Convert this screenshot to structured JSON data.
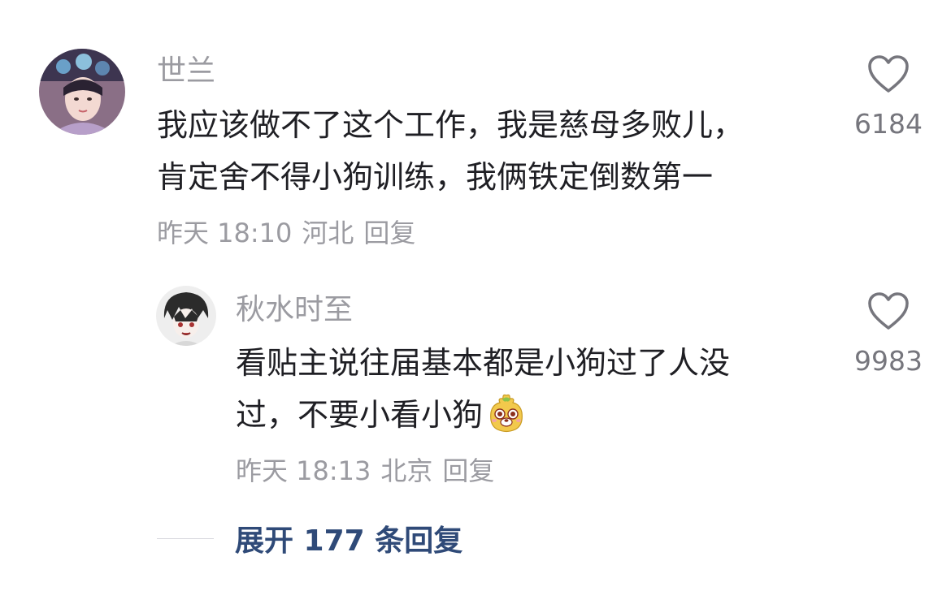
{
  "comments": [
    {
      "username": "世兰",
      "content_lines": [
        "我应该做不了这个工作，我是慈母多败儿，",
        "肯定舍不得小狗训练，我俩铁定倒数第一"
      ],
      "time": "昨天 18:10",
      "location": "河北",
      "reply_label": "回复",
      "likes": "6184",
      "avatar_icon": "avatar-woman-icon",
      "replies": [
        {
          "username": "秋水时至",
          "content_lines": [
            "看贴主说往届基本都是小狗过了人没",
            "过，不要小看小狗"
          ],
          "emoji_icon": "dog-face-emoji",
          "time": "昨天 18:13",
          "location": "北京",
          "reply_label": "回复",
          "likes": "9983",
          "avatar_icon": "avatar-anime-icon"
        }
      ]
    }
  ],
  "expand_replies": "展开 177 条回复",
  "colors": {
    "link": "#2f4a78",
    "meta": "#9b9ba1",
    "text": "#1f1f24"
  }
}
